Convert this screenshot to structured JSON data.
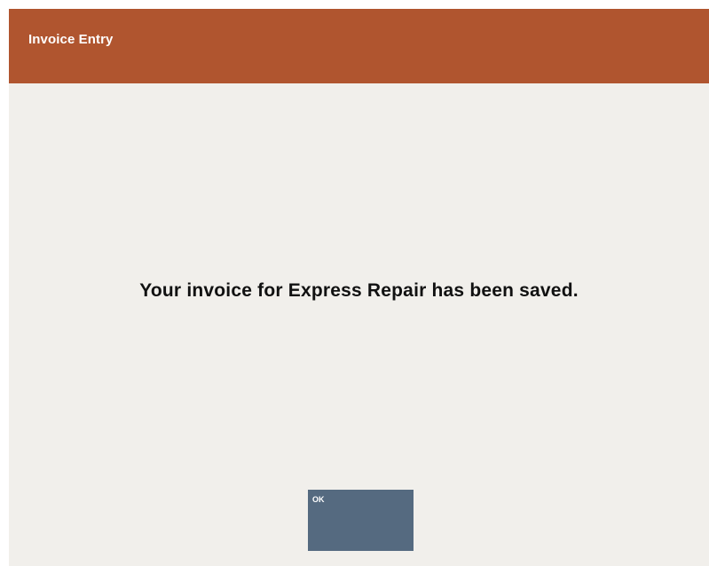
{
  "header": {
    "title": "Invoice Entry",
    "color": "#b0552f"
  },
  "main": {
    "message": "Your invoice for Express Repair has been saved.",
    "background": "#f1efeb"
  },
  "actions": {
    "ok_label": "OK",
    "ok_color": "#556a80"
  }
}
